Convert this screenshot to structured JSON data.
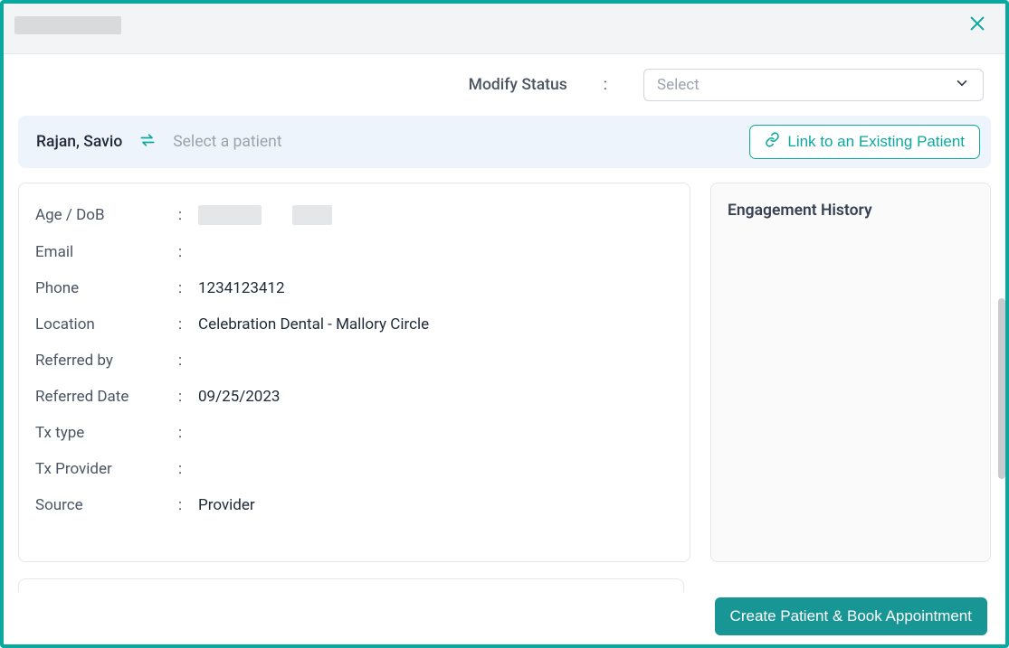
{
  "header": {
    "title_redacted": true
  },
  "status": {
    "label": "Modify Status",
    "colon": ":",
    "placeholder": "Select"
  },
  "linkBar": {
    "currentPatient": "Rajan, Savio",
    "placeholder": "Select a patient",
    "buttonLabel": "Link to an Existing Patient"
  },
  "details": {
    "rows": [
      {
        "label": "Age / DoB",
        "value": "",
        "redacted": true
      },
      {
        "label": "Email",
        "value": ""
      },
      {
        "label": "Phone",
        "value": "1234123412"
      },
      {
        "label": "Location",
        "value": "Celebration Dental - Mallory Circle"
      },
      {
        "label": "Referred by",
        "value": ""
      },
      {
        "label": "Referred Date",
        "value": "09/25/2023"
      },
      {
        "label": "Tx type",
        "value": ""
      },
      {
        "label": "Tx Provider",
        "value": ""
      },
      {
        "label": "Source",
        "value": "Provider"
      }
    ],
    "colon": ":"
  },
  "history": {
    "title": "Engagement History"
  },
  "footer": {
    "primaryButton": "Create Patient & Book Appointment"
  }
}
